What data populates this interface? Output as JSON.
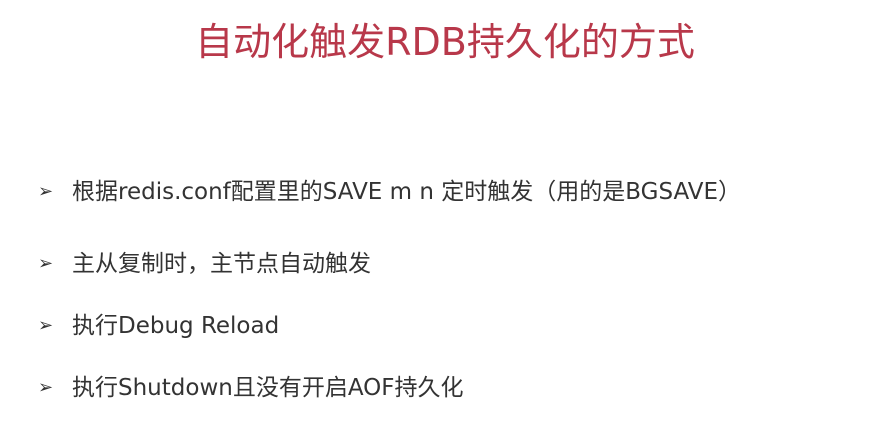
{
  "title": "自动化触发RDB持久化的方式",
  "bullet_marker": "➢",
  "bullets": [
    "根据redis.conf配置里的SAVE m n 定时触发（用的是BGSAVE）",
    "主从复制时，主节点自动触发",
    "执行Debug Reload",
    "执行Shutdown且没有开启AOF持久化"
  ],
  "colors": {
    "title": "#b8384a",
    "text": "#333333",
    "background": "#ffffff"
  }
}
